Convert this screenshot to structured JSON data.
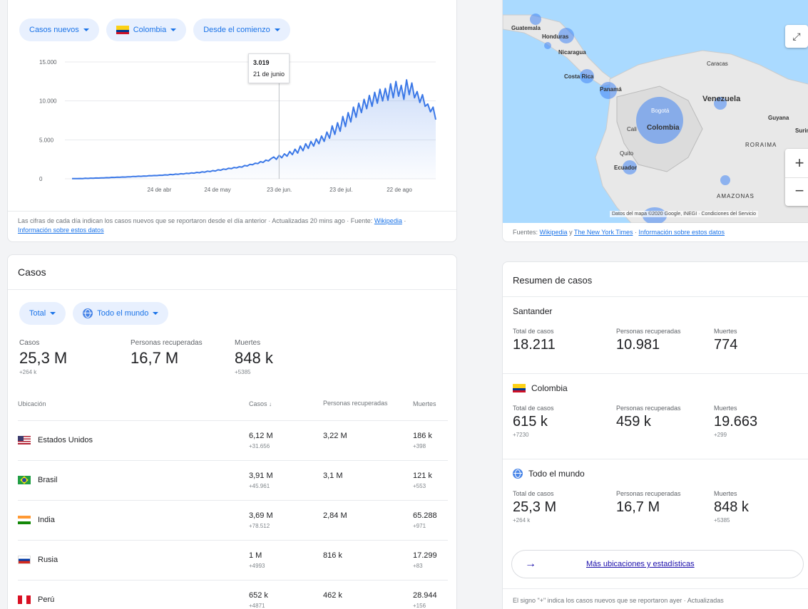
{
  "chart_card": {
    "chips": [
      "Casos nuevos",
      "Colombia",
      "Desde el comienzo"
    ],
    "tooltip": {
      "value": "3.019",
      "date": "21 de junio"
    },
    "footnote": "Las cifras de cada día indican los casos nuevos que se reportaron desde el día anterior · Actualizadas 20 mins ago · Fuente:",
    "source_link": "Wikipedia",
    "info_link": "Información sobre estos datos"
  },
  "chart_data": {
    "type": "area",
    "y_ticks": [
      "15.000",
      "10.000",
      "5.000",
      "0"
    ],
    "x_ticks": [
      "24 de abr",
      "24 de may",
      "23 de jun.",
      "23 de jul.",
      "22 de ago"
    ],
    "ylim": [
      0,
      15000
    ],
    "color": "#3b78e7",
    "series": [
      {
        "values": [
          20,
          30,
          20,
          40,
          30,
          60,
          50,
          80,
          70,
          100,
          90,
          120,
          110,
          150,
          140,
          180,
          170,
          200,
          190,
          230,
          220,
          260,
          250,
          300,
          280,
          330,
          310,
          360,
          340,
          400,
          380,
          420,
          410,
          460,
          450,
          500,
          480,
          560,
          520,
          600,
          580,
          650,
          620,
          700,
          680,
          760,
          720,
          820,
          780,
          900,
          850,
          980,
          920,
          1050,
          1000,
          1150,
          1100,
          1250,
          1200,
          1350,
          1300,
          1450,
          1400,
          1550,
          1500,
          1700,
          1650,
          1850,
          1800,
          2000,
          1950,
          2200,
          2100,
          2400,
          2300,
          2600,
          2800,
          2500,
          3019,
          2700,
          3200,
          2900,
          3500,
          3100,
          3800,
          3300,
          4200,
          3600,
          4500,
          3900,
          4800,
          4200,
          5100,
          4500,
          5500,
          4800,
          6000,
          5200,
          6800,
          5700,
          7200,
          6100,
          8000,
          6700,
          8500,
          7300,
          9200,
          7900,
          9700,
          8500,
          10200,
          9000,
          10700,
          9300,
          11100,
          9700,
          11500,
          10000,
          11600,
          10100,
          12200,
          10400,
          12500,
          10600,
          12000,
          10200,
          12700,
          10800,
          12300,
          10400,
          11200,
          9800,
          10800,
          9300,
          9600,
          8600,
          9200,
          7600
        ]
      }
    ]
  },
  "map_card": {
    "labels": [
      "Guatemala",
      "Honduras",
      "Nicaragua",
      "Costa Rica",
      "Panamá",
      "Caracas",
      "Venezuela",
      "Bogotá",
      "Colombia",
      "Cali",
      "Guyana",
      "Surin",
      "RORAIMA",
      "Quito",
      "Ecuador",
      "AMAZONAS"
    ],
    "attribution": "Datos del mapa ©2020 Google, INEGI · Condiciones del Servicio",
    "sources_prefix": "Fuentes:",
    "source_1": "Wikipedia",
    "and": "y",
    "source_2": "The New York Times",
    "info_link": "Información sobre estos datos",
    "zoom_in": "+",
    "zoom_out": "−"
  },
  "cases_card": {
    "title": "Casos",
    "chips": [
      "Total",
      "Todo el mundo"
    ],
    "stats": [
      {
        "label": "Casos",
        "value": "25,3 M",
        "delta": "+264 k"
      },
      {
        "label": "Personas recuperadas",
        "value": "16,7 M",
        "delta": ""
      },
      {
        "label": "Muertes",
        "value": "848 k",
        "delta": "+5385"
      }
    ],
    "columns": [
      "Ubicación",
      "Casos",
      "Personas recuperadas",
      "Muertes"
    ],
    "rows": [
      {
        "name": "Estados Unidos",
        "cases": "6,12 M",
        "cases_delta": "+31.656",
        "recovered": "3,22 M",
        "deaths": "186 k",
        "deaths_delta": "+398"
      },
      {
        "name": "Brasil",
        "cases": "3,91 M",
        "cases_delta": "+45.961",
        "recovered": "3,1 M",
        "deaths": "121 k",
        "deaths_delta": "+553"
      },
      {
        "name": "India",
        "cases": "3,69 M",
        "cases_delta": "+78.512",
        "recovered": "2,84 M",
        "deaths": "65.288",
        "deaths_delta": "+971"
      },
      {
        "name": "Rusia",
        "cases": "1 M",
        "cases_delta": "+4993",
        "recovered": "816 k",
        "deaths": "17.299",
        "deaths_delta": "+83"
      },
      {
        "name": "Perú",
        "cases": "652 k",
        "cases_delta": "+4871",
        "recovered": "462 k",
        "deaths": "28.944",
        "deaths_delta": "+156"
      }
    ]
  },
  "summary_card": {
    "title": "Resumen de casos",
    "sections": [
      {
        "name": "Santander",
        "stats": [
          {
            "label": "Total de casos",
            "value": "18.211",
            "delta": ""
          },
          {
            "label": "Personas recuperadas",
            "value": "10.981",
            "delta": ""
          },
          {
            "label": "Muertes",
            "value": "774",
            "delta": ""
          }
        ]
      },
      {
        "name": "Colombia",
        "stats": [
          {
            "label": "Total de casos",
            "value": "615 k",
            "delta": "+7230"
          },
          {
            "label": "Personas recuperadas",
            "value": "459 k",
            "delta": ""
          },
          {
            "label": "Muertes",
            "value": "19.663",
            "delta": "+299"
          }
        ]
      },
      {
        "name": "Todo el mundo",
        "stats": [
          {
            "label": "Total de casos",
            "value": "25,3 M",
            "delta": "+264 k"
          },
          {
            "label": "Personas recuperadas",
            "value": "16,7 M",
            "delta": ""
          },
          {
            "label": "Muertes",
            "value": "848 k",
            "delta": "+5385"
          }
        ]
      }
    ],
    "more_link": "Más ubicaciones y estadísticas",
    "footnote": "El signo \"+\" indica los casos nuevos que se reportaron ayer · Actualizadas"
  }
}
